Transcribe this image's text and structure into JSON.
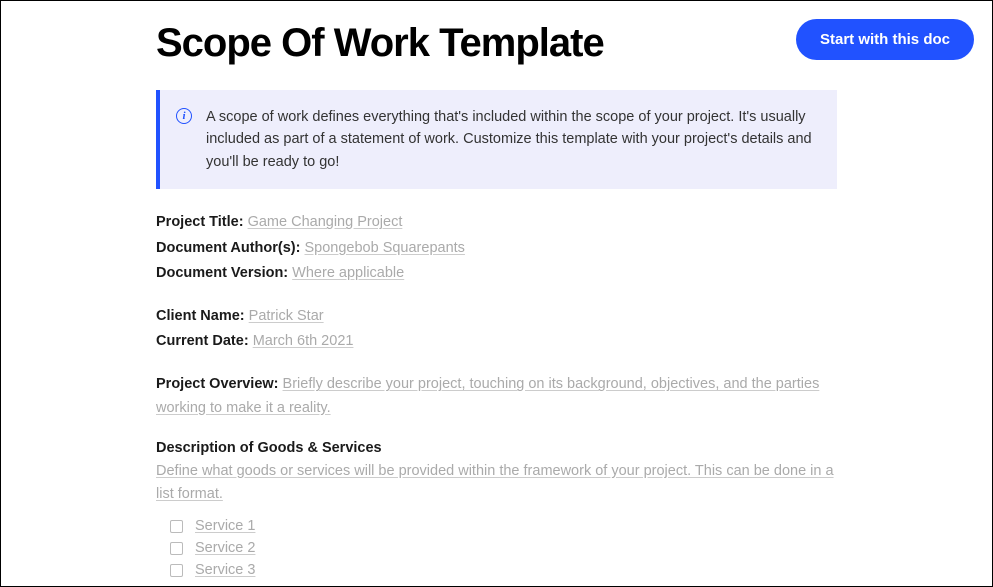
{
  "title": "Scope Of Work Template",
  "cta": "Start with this doc",
  "callout": {
    "icon": "i",
    "text": "A scope of work defines everything that's included within the scope of your project. It's usually included as part of a statement of work. Customize this template with your project's details and you'll be ready to go!"
  },
  "fields": {
    "projectTitle": {
      "label": "Project Title:",
      "value": "Game Changing Project"
    },
    "authors": {
      "label": "Document Author(s):",
      "value": "Spongebob Squarepants"
    },
    "version": {
      "label": "Document Version:",
      "value": "Where applicable"
    },
    "clientName": {
      "label": "Client Name:",
      "value": "Patrick Star"
    },
    "currentDate": {
      "label": "Current Date:",
      "value": "March 6th 2021"
    },
    "overview": {
      "label": "Project Overview:",
      "value": "Briefly describe your project, touching on its background, objectives, and the parties working to make it a reality."
    }
  },
  "goodsServices": {
    "heading": "Description of Goods & Services",
    "description": "Define what goods or services will be provided within the framework of your project. This can be done in a list format.",
    "items": [
      "Service 1",
      "Service 2",
      "Service 3"
    ]
  }
}
